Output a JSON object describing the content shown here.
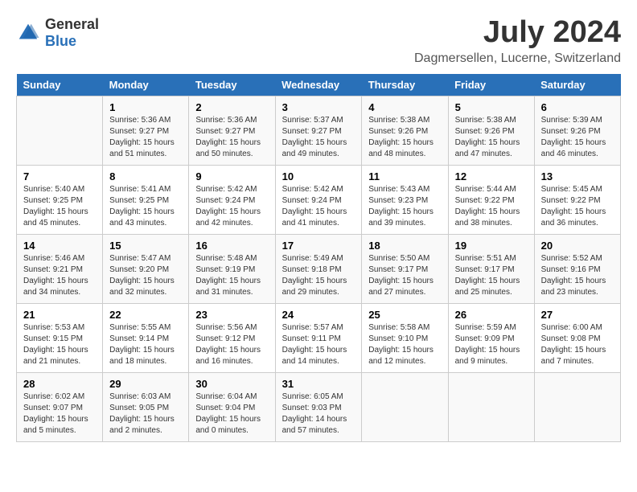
{
  "logo": {
    "general": "General",
    "blue": "Blue"
  },
  "title": {
    "month_year": "July 2024",
    "location": "Dagmersellen, Lucerne, Switzerland"
  },
  "headers": [
    "Sunday",
    "Monday",
    "Tuesday",
    "Wednesday",
    "Thursday",
    "Friday",
    "Saturday"
  ],
  "weeks": [
    [
      {
        "day": "",
        "info": ""
      },
      {
        "day": "1",
        "info": "Sunrise: 5:36 AM\nSunset: 9:27 PM\nDaylight: 15 hours\nand 51 minutes."
      },
      {
        "day": "2",
        "info": "Sunrise: 5:36 AM\nSunset: 9:27 PM\nDaylight: 15 hours\nand 50 minutes."
      },
      {
        "day": "3",
        "info": "Sunrise: 5:37 AM\nSunset: 9:27 PM\nDaylight: 15 hours\nand 49 minutes."
      },
      {
        "day": "4",
        "info": "Sunrise: 5:38 AM\nSunset: 9:26 PM\nDaylight: 15 hours\nand 48 minutes."
      },
      {
        "day": "5",
        "info": "Sunrise: 5:38 AM\nSunset: 9:26 PM\nDaylight: 15 hours\nand 47 minutes."
      },
      {
        "day": "6",
        "info": "Sunrise: 5:39 AM\nSunset: 9:26 PM\nDaylight: 15 hours\nand 46 minutes."
      }
    ],
    [
      {
        "day": "7",
        "info": "Sunrise: 5:40 AM\nSunset: 9:25 PM\nDaylight: 15 hours\nand 45 minutes."
      },
      {
        "day": "8",
        "info": "Sunrise: 5:41 AM\nSunset: 9:25 PM\nDaylight: 15 hours\nand 43 minutes."
      },
      {
        "day": "9",
        "info": "Sunrise: 5:42 AM\nSunset: 9:24 PM\nDaylight: 15 hours\nand 42 minutes."
      },
      {
        "day": "10",
        "info": "Sunrise: 5:42 AM\nSunset: 9:24 PM\nDaylight: 15 hours\nand 41 minutes."
      },
      {
        "day": "11",
        "info": "Sunrise: 5:43 AM\nSunset: 9:23 PM\nDaylight: 15 hours\nand 39 minutes."
      },
      {
        "day": "12",
        "info": "Sunrise: 5:44 AM\nSunset: 9:22 PM\nDaylight: 15 hours\nand 38 minutes."
      },
      {
        "day": "13",
        "info": "Sunrise: 5:45 AM\nSunset: 9:22 PM\nDaylight: 15 hours\nand 36 minutes."
      }
    ],
    [
      {
        "day": "14",
        "info": "Sunrise: 5:46 AM\nSunset: 9:21 PM\nDaylight: 15 hours\nand 34 minutes."
      },
      {
        "day": "15",
        "info": "Sunrise: 5:47 AM\nSunset: 9:20 PM\nDaylight: 15 hours\nand 32 minutes."
      },
      {
        "day": "16",
        "info": "Sunrise: 5:48 AM\nSunset: 9:19 PM\nDaylight: 15 hours\nand 31 minutes."
      },
      {
        "day": "17",
        "info": "Sunrise: 5:49 AM\nSunset: 9:18 PM\nDaylight: 15 hours\nand 29 minutes."
      },
      {
        "day": "18",
        "info": "Sunrise: 5:50 AM\nSunset: 9:17 PM\nDaylight: 15 hours\nand 27 minutes."
      },
      {
        "day": "19",
        "info": "Sunrise: 5:51 AM\nSunset: 9:17 PM\nDaylight: 15 hours\nand 25 minutes."
      },
      {
        "day": "20",
        "info": "Sunrise: 5:52 AM\nSunset: 9:16 PM\nDaylight: 15 hours\nand 23 minutes."
      }
    ],
    [
      {
        "day": "21",
        "info": "Sunrise: 5:53 AM\nSunset: 9:15 PM\nDaylight: 15 hours\nand 21 minutes."
      },
      {
        "day": "22",
        "info": "Sunrise: 5:55 AM\nSunset: 9:14 PM\nDaylight: 15 hours\nand 18 minutes."
      },
      {
        "day": "23",
        "info": "Sunrise: 5:56 AM\nSunset: 9:12 PM\nDaylight: 15 hours\nand 16 minutes."
      },
      {
        "day": "24",
        "info": "Sunrise: 5:57 AM\nSunset: 9:11 PM\nDaylight: 15 hours\nand 14 minutes."
      },
      {
        "day": "25",
        "info": "Sunrise: 5:58 AM\nSunset: 9:10 PM\nDaylight: 15 hours\nand 12 minutes."
      },
      {
        "day": "26",
        "info": "Sunrise: 5:59 AM\nSunset: 9:09 PM\nDaylight: 15 hours\nand 9 minutes."
      },
      {
        "day": "27",
        "info": "Sunrise: 6:00 AM\nSunset: 9:08 PM\nDaylight: 15 hours\nand 7 minutes."
      }
    ],
    [
      {
        "day": "28",
        "info": "Sunrise: 6:02 AM\nSunset: 9:07 PM\nDaylight: 15 hours\nand 5 minutes."
      },
      {
        "day": "29",
        "info": "Sunrise: 6:03 AM\nSunset: 9:05 PM\nDaylight: 15 hours\nand 2 minutes."
      },
      {
        "day": "30",
        "info": "Sunrise: 6:04 AM\nSunset: 9:04 PM\nDaylight: 15 hours\nand 0 minutes."
      },
      {
        "day": "31",
        "info": "Sunrise: 6:05 AM\nSunset: 9:03 PM\nDaylight: 14 hours\nand 57 minutes."
      },
      {
        "day": "",
        "info": ""
      },
      {
        "day": "",
        "info": ""
      },
      {
        "day": "",
        "info": ""
      }
    ]
  ]
}
